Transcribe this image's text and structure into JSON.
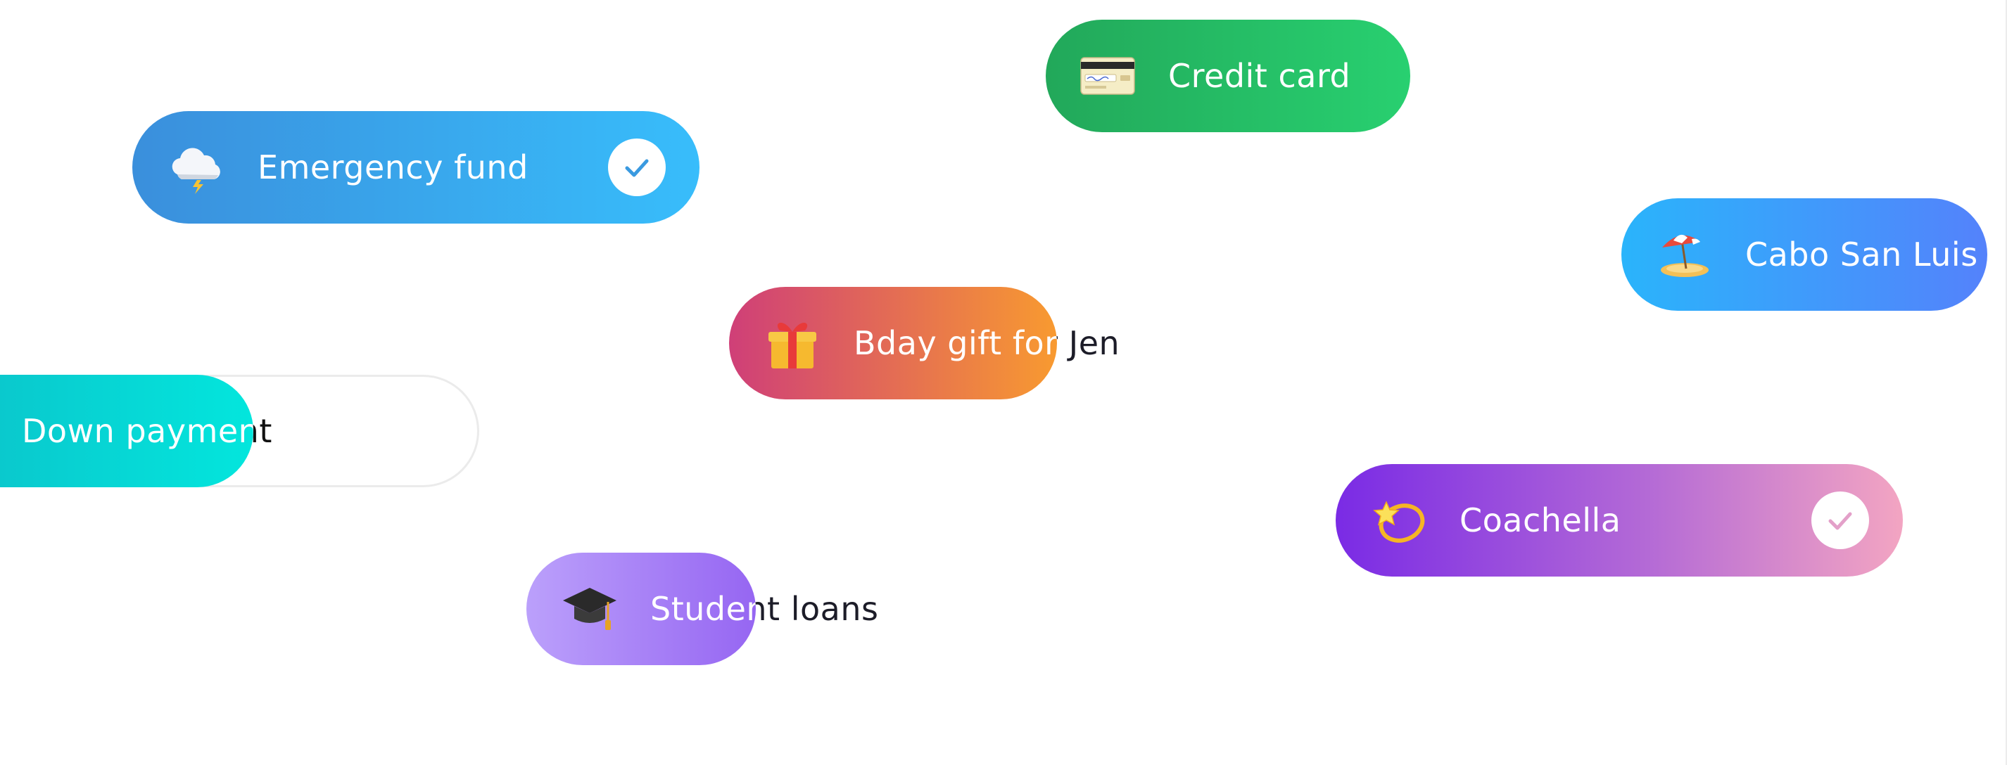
{
  "goals": {
    "credit_card": {
      "label": "Credit card",
      "icon": "credit-card-icon",
      "glyph": "💳",
      "colors": [
        "#22a85a",
        "#28d070"
      ]
    },
    "emergency_fund": {
      "label": "Emergency fund",
      "icon": "cloud-lightning-icon",
      "glyph": "🌩️",
      "colors": [
        "#3a8fdc",
        "#38bdfb"
      ],
      "completed": true,
      "check_color": "#3a9ae0"
    },
    "cabo": {
      "label": "Cabo San Luis",
      "icon": "beach-umbrella-icon",
      "glyph": "🏝️",
      "colors": [
        "#2ab4fb",
        "#5482fb"
      ]
    },
    "bday_gift": {
      "label": "Bday gift for Jen",
      "icon": "gift-icon",
      "glyph": "🎁",
      "colors": [
        "#cf3f78",
        "#f89a30"
      ],
      "progress": 0.59
    },
    "down_payment": {
      "label": "Down payment",
      "colors": [
        "#0cbfc8",
        "#03e6dd"
      ],
      "progress": 0.53
    },
    "coachella": {
      "label": "Coachella",
      "icon": "dizzy-star-icon",
      "glyph": "💫",
      "colors": [
        "#7a2be5",
        "#f3a5c2"
      ],
      "completed": true,
      "check_color": "#e3a0c9"
    },
    "student_loans": {
      "label": "Student loans",
      "icon": "graduation-cap-icon",
      "glyph": "🎓",
      "colors": [
        "#bba0fb",
        "#9666f2"
      ],
      "progress": 0.68
    }
  }
}
